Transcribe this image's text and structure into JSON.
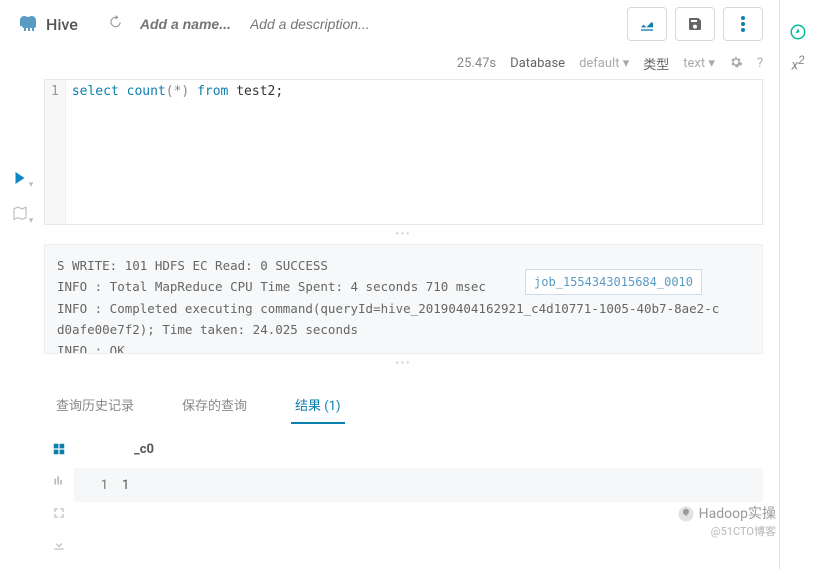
{
  "header": {
    "app_name": "Hive",
    "name_placeholder": "Add a name...",
    "desc_placeholder": "Add a description..."
  },
  "subheader": {
    "exec_time": "25.47s",
    "database_label": "Database",
    "database_value": "default",
    "type_label": "类型",
    "type_value": "text"
  },
  "editor": {
    "line_no": "1",
    "sql_select": "select",
    "sql_count": "count",
    "sql_star": "(*)",
    "sql_from": "from",
    "sql_table": "test2",
    "sql_semi": ";"
  },
  "log": {
    "line1": "S WRITE: 101 HDFS EC Read: 0 SUCCESS",
    "line2": "INFO  : Total MapReduce CPU Time Spent: 4 seconds 710 msec",
    "line3": "INFO  : Completed executing command(queryId=hive_20190404162921_c4d10771-1005-40b7-8ae2-c",
    "line4": "d0afe00e7f2); Time taken: 24.025 seconds",
    "line5": "INFO  : OK",
    "job_link": "job_1554343015684_0010"
  },
  "tabs": {
    "history": "查询历史记录",
    "saved": "保存的查询",
    "results": "结果 (1)"
  },
  "result": {
    "col": "_c0",
    "row_idx": "1",
    "row_val": "1"
  },
  "watermark": {
    "title": "Hadoop实操",
    "sub": "@51CTO博客"
  }
}
